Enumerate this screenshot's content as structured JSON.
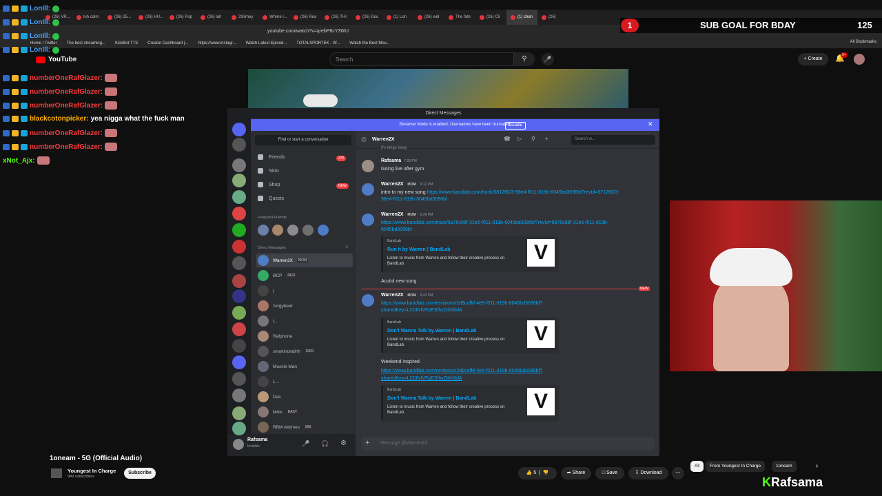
{
  "browser": {
    "tabs": [
      "(26) VR...",
      "luh calm",
      "(26) 25...",
      "(26) HU...",
      "(26) Pop",
      "(26) luh",
      "2Slimey",
      "Where i...",
      "(26) Rea",
      "(26) THI",
      "(26) Dou",
      "(1) Lon",
      "(26) wid",
      "The fate",
      "(26) Cli",
      "(1) chan",
      "(26)"
    ],
    "url": "youtube.com/watch?v=qrebP8cY3WU",
    "bookmarks": [
      "Home / Twitter",
      "The best streaming...",
      "KickBot TTS",
      "Creator Dashboard |...",
      "https://www.instagr...",
      "Watch Latest Episod...",
      "TOTALSPORTEK - W...",
      "Watch the Best Mov..."
    ],
    "all_bookmarks": "All Bookmarks"
  },
  "youtube": {
    "logo": "YouTube",
    "search_placeholder": "Search",
    "create": "Create",
    "notif_count": "9+",
    "video_title": "1oneam - 5G (Official Audio)",
    "channel": "Youngest In Charge",
    "subs": "949 subscribers",
    "subscribe": "Subscribe",
    "likes": "5",
    "share": "Share",
    "save": "Save",
    "download": "Download",
    "chips": [
      "All",
      "From Youngest In Charge",
      "1oneam"
    ]
  },
  "overlay": {
    "goal_badge": "1",
    "goal_text": "SUB GOAL FOR BDAY",
    "goal_count": "125",
    "brand": "Rafsama"
  },
  "chat": [
    {
      "user": "LonIll:",
      "text": "",
      "color": "#4ea3ff"
    },
    {
      "user": "LonIll:",
      "text": "",
      "color": "#4ea3ff"
    },
    {
      "user": "LonIll:",
      "text": "",
      "color": "#4ea3ff"
    },
    {
      "user": "LonIll:",
      "text": "",
      "color": "#4ea3ff"
    },
    {
      "user": "numberOneRafGlazer:",
      "text": "",
      "color": "#ff3b3b"
    },
    {
      "user": "numberOneRafGlazer:",
      "text": "",
      "color": "#ff3b3b"
    },
    {
      "user": "numberOneRafGlazer:",
      "text": "",
      "color": "#ff3b3b"
    },
    {
      "user": "blackcotonpicker:",
      "text": "yea nigga what the fuck man",
      "color": "#ffb000"
    },
    {
      "user": "numberOneRafGlazer:",
      "text": "",
      "color": "#ff3b3b"
    },
    {
      "user": "numberOneRafGlazer:",
      "text": "",
      "color": "#ff3b3b"
    },
    {
      "user": "xNot_Ajx:",
      "text": "",
      "color": "#53fc18"
    }
  ],
  "discord": {
    "window_title": "Direct Messages",
    "banner": "Streamer Mode is enabled. Usernames have been truncated.",
    "banner_btn": "Disable",
    "find": "Find or start a conversation",
    "nav": [
      {
        "label": "Friends",
        "pill": "376"
      },
      {
        "label": "Nitro",
        "pill": ""
      },
      {
        "label": "Shop",
        "pill": "NEW"
      },
      {
        "label": "Quests",
        "pill": ""
      }
    ],
    "frequent": "Frequent Friends",
    "dm_header": "Direct Messages",
    "dms": [
      {
        "name": "Warren2X",
        "tag": "MOM"
      },
      {
        "name": "BCP",
        "tag": "DEO"
      },
      {
        "name": "|",
        "tag": ""
      },
      {
        "name": "zergybear",
        "tag": ""
      },
      {
        "name": "t...",
        "tag": ""
      },
      {
        "name": "Rafphone",
        "tag": ""
      },
      {
        "name": "smokinondihh",
        "tag": "DEO"
      },
      {
        "name": "Muscle Man",
        "tag": ""
      },
      {
        "name": "L...",
        "tag": ""
      },
      {
        "name": "Das",
        "tag": ""
      },
      {
        "name": "Mike",
        "tag": "EASY"
      },
      {
        "name": "RBM Aktimes",
        "tag": "556"
      }
    ],
    "user": "Rafsama",
    "user_status": "Invisible",
    "channel": "Warren2X",
    "search_placeholder": "Search w...",
    "partial_top": "it's kings bday",
    "messages": [
      {
        "name": "Rafsama",
        "time": "7:28 PM",
        "lines": [
          "Going live after gym"
        ]
      },
      {
        "name": "Warren2X",
        "tag": "MOM",
        "time": "9:12 PM",
        "lines": [
          "intro to my new song https://www.bandlab.com/track/5812f823-98e4-f011-819b-6045bd3096bf?revId=5712f823-",
          "98e4-f011-819b-6045bd3096bf"
        ]
      },
      {
        "name": "Warren2X",
        "tag": "MOM",
        "time": "9:26 PM",
        "lines": [
          "https://www.bandlab.com/track/6a76c98f-31e5-f011-819b-6045bd3096bf?revId=6876c98f-31e5-f011-819b-",
          "6045bd3096bf"
        ]
      },
      {
        "name": "Warren2X",
        "tag": "MOM",
        "time": "9:42 PM",
        "lines": [
          "https://www.bandlab.com/revisions/2d9caffd-4e5-f011-819b-6045bd3096bf?",
          "sharedKey=LC0INIVFpESfhyOthli0dA"
        ]
      }
    ],
    "embeds": [
      {
        "src": "BandLab",
        "title": "Run it by Warren | BandLab",
        "desc1": "Listen to music from Warren and follow their creative process on",
        "desc2": "BandLab."
      },
      {
        "src": "BandLab",
        "title": "Don't Wanna Talk by Warren | BandLab",
        "desc1": "Listen to music from Warren and follow their creative process on",
        "desc2": "BandLab."
      },
      {
        "src": "BandLab",
        "title": "Don't Wanna Talk by Warren | BandLab",
        "desc1": "Listen to music from Warren and follow their creative process on",
        "desc2": "BandLab."
      }
    ],
    "standalone1": "Acutul new song",
    "new_tag": "NEW",
    "standalone2": "Weekend inspired",
    "link2": [
      "https://www.bandlab.com/revisions/2d9caffd-4e5-f011-819b-6045bd3096bf?",
      "sharedKey=LC0INIVFpESfhyOthli0dA"
    ],
    "composer": "Message @Warren2X"
  }
}
